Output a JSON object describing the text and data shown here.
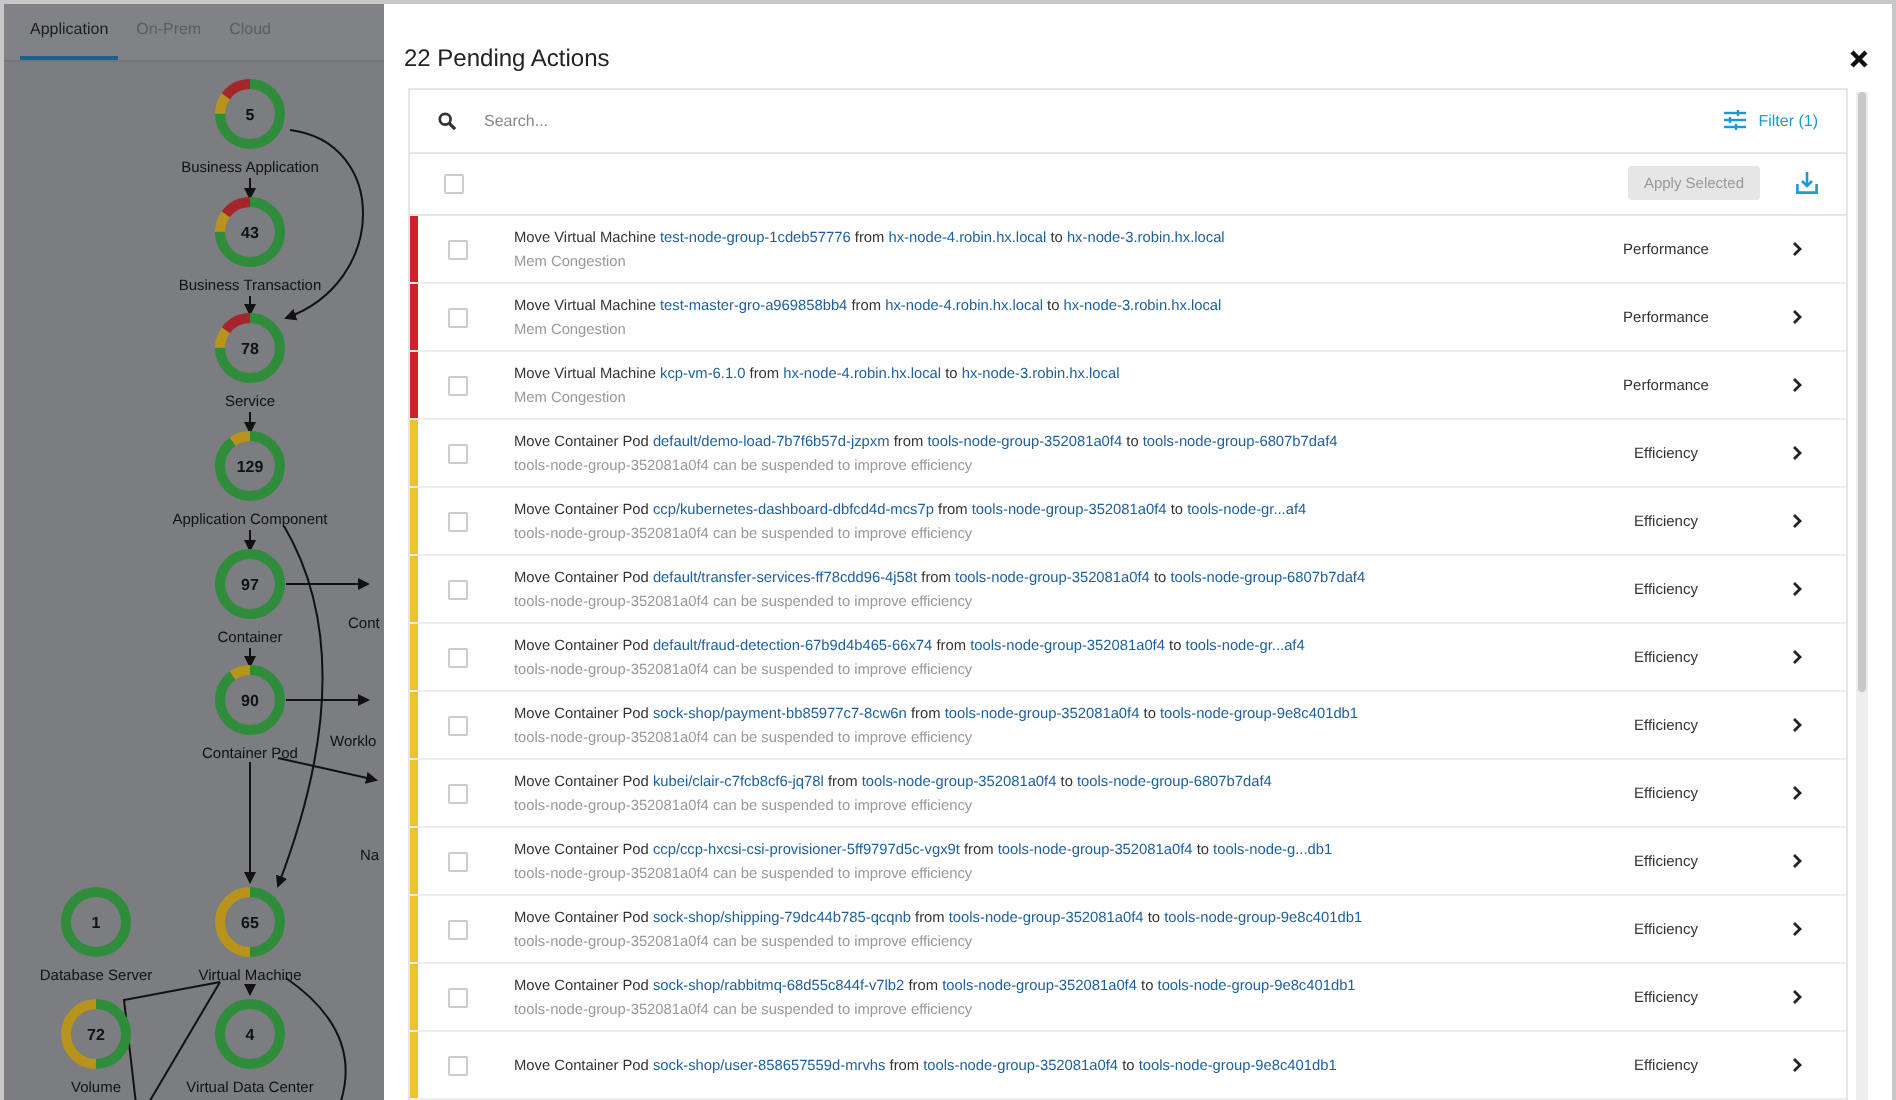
{
  "topology": {
    "tabs": [
      {
        "label": "Application",
        "selected": true
      },
      {
        "label": "On-Prem",
        "selected": false
      },
      {
        "label": "Cloud",
        "selected": false
      }
    ],
    "nodes": [
      {
        "label": "Business Application",
        "count": "5",
        "kind": "critical"
      },
      {
        "label": "Business Transaction",
        "count": "43",
        "kind": "critical"
      },
      {
        "label": "Service",
        "count": "78",
        "kind": "critical"
      },
      {
        "label": "Application Component",
        "count": "129",
        "kind": "minor"
      },
      {
        "label": "Container",
        "count": "97",
        "kind": "healthy"
      },
      {
        "label": "Container Pod",
        "count": "90",
        "kind": "minor"
      },
      {
        "label": "Database Server",
        "count": "1",
        "kind": "healthy"
      },
      {
        "label": "Virtual Machine",
        "count": "65",
        "kind": "major"
      },
      {
        "label": "Volume",
        "count": "72",
        "kind": "major"
      },
      {
        "label": "Virtual Data Center",
        "count": "4",
        "kind": "healthy"
      }
    ],
    "edge_labels": [
      "Cont",
      "Worklo",
      "Na"
    ]
  },
  "drawer": {
    "title": "22 Pending Actions",
    "search": {
      "placeholder": "Search..."
    },
    "filter": "Filter (1)",
    "apply": {
      "label": "Apply Selected",
      "disabled": true
    },
    "select_all": {
      "checked": false
    },
    "rows": [
      {
        "color": "#d0202a",
        "checked": false,
        "parts": [
          {
            "kind": "plain",
            "text": "Move Virtual Machine"
          },
          {
            "kind": "link",
            "text": "test-node-group-1cdeb57776"
          },
          {
            "kind": "plain",
            "text": "from"
          },
          {
            "kind": "link",
            "text": "hx-node-4.robin.hx.local"
          },
          {
            "kind": "plain",
            "text": "to"
          },
          {
            "kind": "link",
            "text": "hx-node-3.robin.hx.local"
          }
        ],
        "reason": "Mem Congestion",
        "category": "Performance"
      },
      {
        "color": "#d0202a",
        "checked": false,
        "parts": [
          {
            "kind": "plain",
            "text": "Move Virtual Machine"
          },
          {
            "kind": "link",
            "text": "test-master-gro-a969858bb4"
          },
          {
            "kind": "plain",
            "text": "from"
          },
          {
            "kind": "link",
            "text": "hx-node-4.robin.hx.local"
          },
          {
            "kind": "plain",
            "text": "to"
          },
          {
            "kind": "link",
            "text": "hx-node-3.robin.hx.local"
          }
        ],
        "reason": "Mem Congestion",
        "category": "Performance"
      },
      {
        "color": "#d0202a",
        "checked": false,
        "parts": [
          {
            "kind": "plain",
            "text": "Move Virtual Machine"
          },
          {
            "kind": "link",
            "text": "kcp-vm-6.1.0"
          },
          {
            "kind": "plain",
            "text": "from"
          },
          {
            "kind": "link",
            "text": "hx-node-4.robin.hx.local"
          },
          {
            "kind": "plain",
            "text": "to"
          },
          {
            "kind": "link",
            "text": "hx-node-3.robin.hx.local"
          }
        ],
        "reason": "Mem Congestion",
        "category": "Performance"
      },
      {
        "color": "#f2c12e",
        "checked": false,
        "parts": [
          {
            "kind": "plain",
            "text": "Move Container Pod"
          },
          {
            "kind": "link",
            "text": "default/demo-load-7b7f6b57d-jzpxm"
          },
          {
            "kind": "plain",
            "text": "from"
          },
          {
            "kind": "link",
            "text": "tools-node-group-352081a0f4"
          },
          {
            "kind": "plain",
            "text": "to"
          },
          {
            "kind": "link",
            "text": "tools-node-group-6807b7daf4"
          }
        ],
        "reason": "tools-node-group-352081a0f4 can be suspended to improve efficiency",
        "category": "Efficiency"
      },
      {
        "color": "#f2c12e",
        "checked": false,
        "parts": [
          {
            "kind": "plain",
            "text": "Move Container Pod"
          },
          {
            "kind": "link",
            "text": "ccp/kubernetes-dashboard-dbfcd4d-mcs7p"
          },
          {
            "kind": "plain",
            "text": "from"
          },
          {
            "kind": "link",
            "text": "tools-node-group-352081a0f4"
          },
          {
            "kind": "plain",
            "text": "to"
          },
          {
            "kind": "link",
            "text": "tools-node-gr...af4"
          }
        ],
        "reason": "tools-node-group-352081a0f4 can be suspended to improve efficiency",
        "category": "Efficiency"
      },
      {
        "color": "#f2c12e",
        "checked": false,
        "parts": [
          {
            "kind": "plain",
            "text": "Move Container Pod"
          },
          {
            "kind": "link",
            "text": "default/transfer-services-ff78cdd96-4j58t"
          },
          {
            "kind": "plain",
            "text": "from"
          },
          {
            "kind": "link",
            "text": "tools-node-group-352081a0f4"
          },
          {
            "kind": "plain",
            "text": "to"
          },
          {
            "kind": "link",
            "text": "tools-node-group-6807b7daf4"
          }
        ],
        "reason": "tools-node-group-352081a0f4 can be suspended to improve efficiency",
        "category": "Efficiency"
      },
      {
        "color": "#f2c12e",
        "checked": false,
        "parts": [
          {
            "kind": "plain",
            "text": "Move Container Pod"
          },
          {
            "kind": "link",
            "text": "default/fraud-detection-67b9d4b465-66x74"
          },
          {
            "kind": "plain",
            "text": "from"
          },
          {
            "kind": "link",
            "text": "tools-node-group-352081a0f4"
          },
          {
            "kind": "plain",
            "text": "to"
          },
          {
            "kind": "link",
            "text": "tools-node-gr...af4"
          }
        ],
        "reason": "tools-node-group-352081a0f4 can be suspended to improve efficiency",
        "category": "Efficiency"
      },
      {
        "color": "#f2c12e",
        "checked": false,
        "parts": [
          {
            "kind": "plain",
            "text": "Move Container Pod"
          },
          {
            "kind": "link",
            "text": "sock-shop/payment-bb85977c7-8cw6n"
          },
          {
            "kind": "plain",
            "text": "from"
          },
          {
            "kind": "link",
            "text": "tools-node-group-352081a0f4"
          },
          {
            "kind": "plain",
            "text": "to"
          },
          {
            "kind": "link",
            "text": "tools-node-group-9e8c401db1"
          }
        ],
        "reason": "tools-node-group-352081a0f4 can be suspended to improve efficiency",
        "category": "Efficiency"
      },
      {
        "color": "#f2c12e",
        "checked": false,
        "parts": [
          {
            "kind": "plain",
            "text": "Move Container Pod"
          },
          {
            "kind": "link",
            "text": "kubei/clair-c7fcb8cf6-jq78l"
          },
          {
            "kind": "plain",
            "text": "from"
          },
          {
            "kind": "link",
            "text": "tools-node-group-352081a0f4"
          },
          {
            "kind": "plain",
            "text": "to"
          },
          {
            "kind": "link",
            "text": "tools-node-group-6807b7daf4"
          }
        ],
        "reason": "tools-node-group-352081a0f4 can be suspended to improve efficiency",
        "category": "Efficiency"
      },
      {
        "color": "#f2c12e",
        "checked": false,
        "parts": [
          {
            "kind": "plain",
            "text": "Move Container Pod"
          },
          {
            "kind": "link",
            "text": "ccp/ccp-hxcsi-csi-provisioner-5ff9797d5c-vgx9t"
          },
          {
            "kind": "plain",
            "text": "from"
          },
          {
            "kind": "link",
            "text": "tools-node-group-352081a0f4"
          },
          {
            "kind": "plain",
            "text": "to"
          },
          {
            "kind": "link",
            "text": "tools-node-g...db1"
          }
        ],
        "reason": "tools-node-group-352081a0f4 can be suspended to improve efficiency",
        "category": "Efficiency"
      },
      {
        "color": "#f2c12e",
        "checked": false,
        "parts": [
          {
            "kind": "plain",
            "text": "Move Container Pod"
          },
          {
            "kind": "link",
            "text": "sock-shop/shipping-79dc44b785-qcqnb"
          },
          {
            "kind": "plain",
            "text": "from"
          },
          {
            "kind": "link",
            "text": "tools-node-group-352081a0f4"
          },
          {
            "kind": "plain",
            "text": "to"
          },
          {
            "kind": "link",
            "text": "tools-node-group-9e8c401db1"
          }
        ],
        "reason": "tools-node-group-352081a0f4 can be suspended to improve efficiency",
        "category": "Efficiency"
      },
      {
        "color": "#f2c12e",
        "checked": false,
        "parts": [
          {
            "kind": "plain",
            "text": "Move Container Pod"
          },
          {
            "kind": "link",
            "text": "sock-shop/rabbitmq-68d55c844f-v7lb2"
          },
          {
            "kind": "plain",
            "text": "from"
          },
          {
            "kind": "link",
            "text": "tools-node-group-352081a0f4"
          },
          {
            "kind": "plain",
            "text": "to"
          },
          {
            "kind": "link",
            "text": "tools-node-group-9e8c401db1"
          }
        ],
        "reason": "tools-node-group-352081a0f4 can be suspended to improve efficiency",
        "category": "Efficiency"
      },
      {
        "color": "#f2c12e",
        "checked": false,
        "parts": [
          {
            "kind": "plain",
            "text": "Move Container Pod"
          },
          {
            "kind": "link",
            "text": "sock-shop/user-858657559d-mrvhs"
          },
          {
            "kind": "plain",
            "text": "from"
          },
          {
            "kind": "link",
            "text": "tools-node-group-352081a0f4"
          },
          {
            "kind": "plain",
            "text": "to"
          },
          {
            "kind": "link",
            "text": "tools-node-group-9e8c401db1"
          }
        ],
        "category": "Efficiency"
      }
    ]
  }
}
